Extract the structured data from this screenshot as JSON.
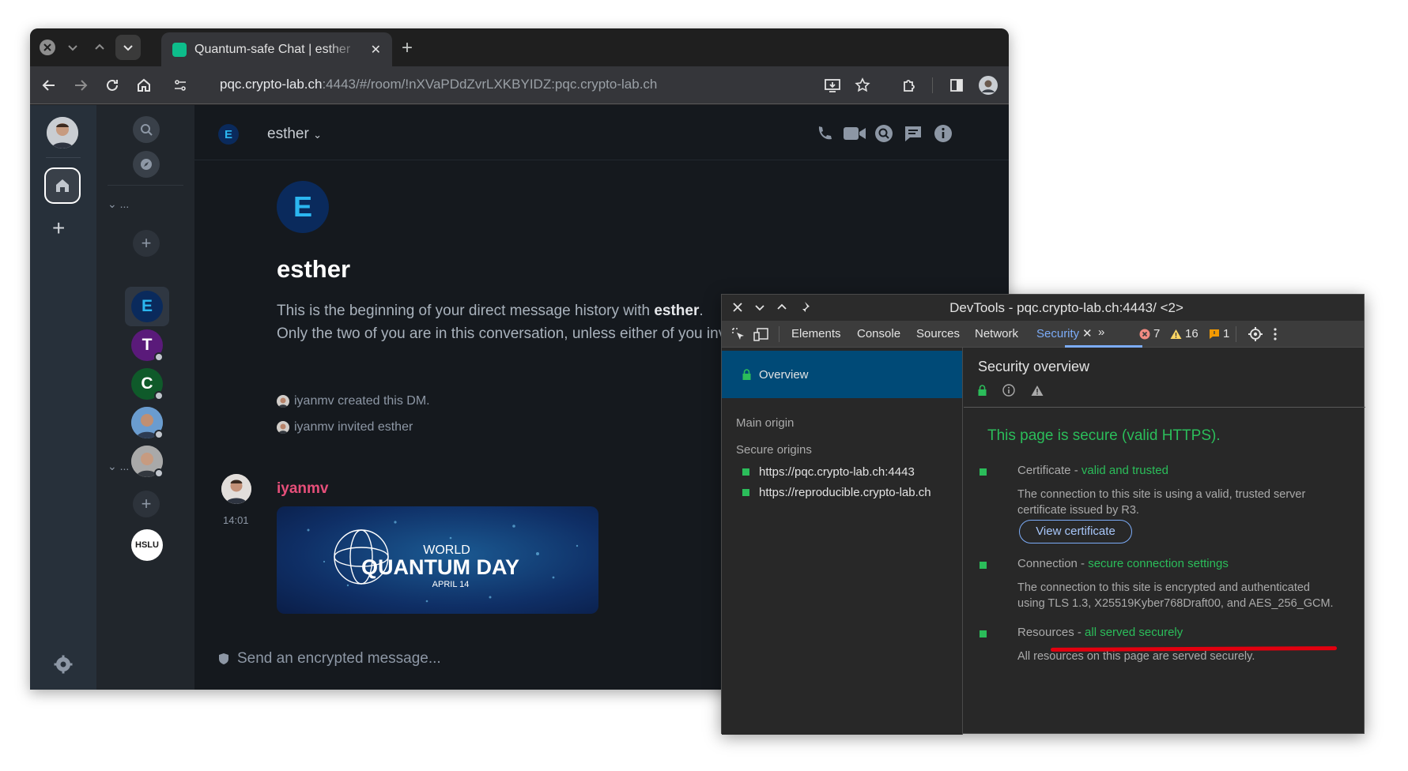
{
  "browser": {
    "tab_title": "Quantum-safe Chat | esther",
    "url_host": "pqc.crypto-lab.ch",
    "url_rest": ":4443/#/room/!nXVaPDdZvrLXKBYIDZ:pqc.crypto-lab.ch"
  },
  "sidebar": {
    "section_label": "...",
    "rooms": [
      {
        "letter": "E",
        "color": "#0a2a5c",
        "text_color": "#2bb6f0"
      },
      {
        "letter": "T",
        "color": "#5a1a7a",
        "text_color": "#ffffff"
      },
      {
        "letter": "C",
        "color": "#0f5a2a",
        "text_color": "#ffffff"
      }
    ],
    "hslu_label": "HSLU"
  },
  "room": {
    "name": "esther",
    "avatar_letter": "E",
    "intro_prefix": "This is the beginning of your direct message history with ",
    "intro_name": "esther",
    "intro_suffix": ".",
    "intro_line2": "Only the two of you are in this conversation, unless either of you invites anyone to join.",
    "events": [
      "iyanmv created this DM.",
      "iyanmv invited esther"
    ],
    "message": {
      "sender": "iyanmv",
      "time": "14:01"
    },
    "image": {
      "line1": "WORLD",
      "line2": "QUANTUM DAY",
      "line3": "APRIL 14"
    },
    "composer_placeholder": "Send an encrypted message..."
  },
  "devtools": {
    "title": "DevTools - pqc.crypto-lab.ch:4443/ <2>",
    "tabs": [
      "Elements",
      "Console",
      "Sources",
      "Network",
      "Security"
    ],
    "active_tab": "Security",
    "errors": "7",
    "warnings": "16",
    "issues": "1",
    "left": {
      "overview": "Overview",
      "main_origin": "Main origin",
      "secure_origins": "Secure origins",
      "origins": [
        "https://pqc.crypto-lab.ch:4443",
        "https://reproducible.crypto-lab.ch"
      ]
    },
    "security": {
      "title": "Security overview",
      "summary": "This page is secure (valid HTTPS).",
      "cert_label": "Certificate - ",
      "cert_status": "valid and trusted",
      "cert_desc": "The connection to this site is using a valid, trusted server certificate issued by R3.",
      "view_cert": "View certificate",
      "conn_label": "Connection - ",
      "conn_status": "secure connection settings",
      "conn_desc1": "The connection to this site is encrypted and authenticated",
      "conn_desc2": "using TLS 1.3, X25519Kyber768Draft00, and AES_256_GCM.",
      "res_label": "Resources - ",
      "res_status": "all served securely",
      "res_desc": "All resources on this page are served securely."
    },
    "colors": {
      "accent": "#7cacf8",
      "secure": "#2bbd5a",
      "error": "#e3000f"
    }
  }
}
